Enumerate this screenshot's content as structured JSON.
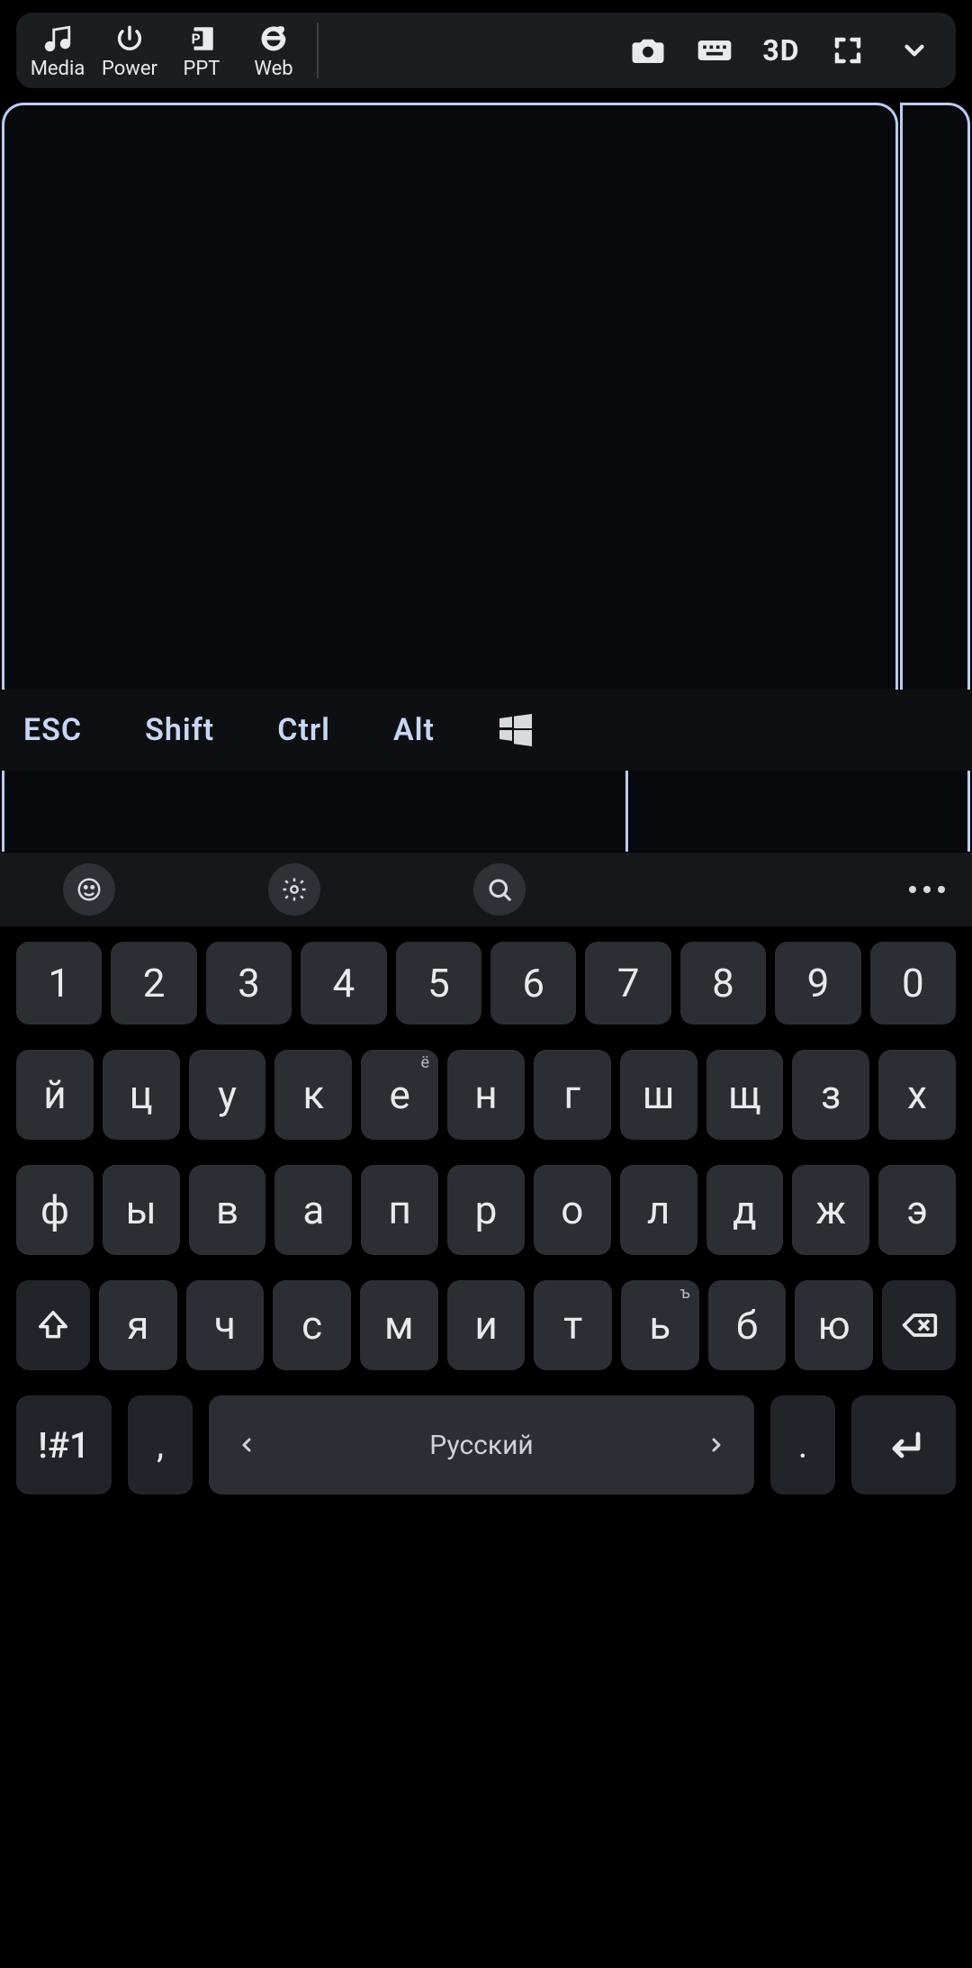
{
  "toolbar": {
    "tabs": [
      {
        "id": "media",
        "label": "Media"
      },
      {
        "id": "power",
        "label": "Power"
      },
      {
        "id": "ppt",
        "label": "PPT"
      },
      {
        "id": "web",
        "label": "Web"
      }
    ],
    "right_icons": {
      "camera": "camera-icon",
      "keyboard": "keyboard-icon",
      "mode3d_label": "3D",
      "fullscreen": "fullscreen-icon",
      "dropdown": "chevron-down-icon"
    }
  },
  "modifiers": {
    "esc": "ESC",
    "shift": "Shift",
    "ctrl": "Ctrl",
    "alt": "Alt"
  },
  "keyboard": {
    "row_numbers": [
      "1",
      "2",
      "3",
      "4",
      "5",
      "6",
      "7",
      "8",
      "9",
      "0"
    ],
    "row2": [
      {
        "k": "й"
      },
      {
        "k": "ц"
      },
      {
        "k": "у"
      },
      {
        "k": "к"
      },
      {
        "k": "е",
        "sup": "ё"
      },
      {
        "k": "н"
      },
      {
        "k": "г"
      },
      {
        "k": "ш"
      },
      {
        "k": "щ"
      },
      {
        "k": "з"
      },
      {
        "k": "х"
      }
    ],
    "row3": [
      "ф",
      "ы",
      "в",
      "а",
      "п",
      "р",
      "о",
      "л",
      "д",
      "ж",
      "э"
    ],
    "row4": [
      {
        "k": "я"
      },
      {
        "k": "ч"
      },
      {
        "k": "с"
      },
      {
        "k": "м"
      },
      {
        "k": "и"
      },
      {
        "k": "т"
      },
      {
        "k": "ь",
        "sup": "ъ"
      },
      {
        "k": "б"
      },
      {
        "k": "ю"
      }
    ],
    "symbols_label": "!#1",
    "comma_label": ",",
    "space_label": "Русский",
    "period_label": ".",
    "shift_icon": "shift-icon",
    "backspace_icon": "backspace-icon",
    "enter_icon": "enter-icon"
  }
}
